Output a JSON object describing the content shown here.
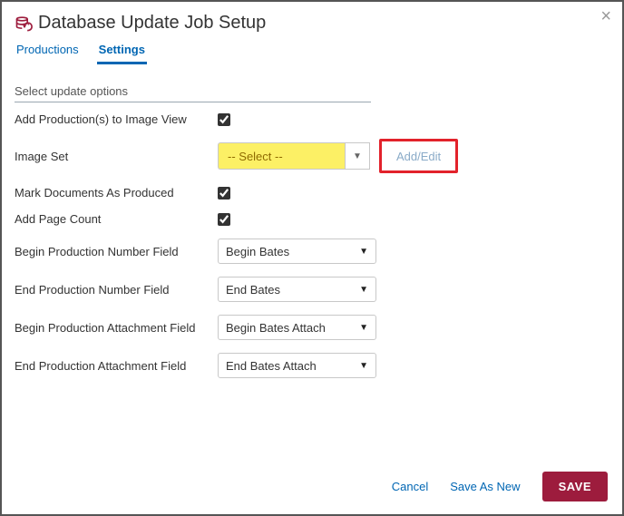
{
  "dialog": {
    "title": "Database Update Job Setup",
    "close_label": "×"
  },
  "tabs": {
    "productions": "Productions",
    "settings": "Settings"
  },
  "section_heading": "Select update options",
  "fields": {
    "add_productions": {
      "label": "Add Production(s) to Image View",
      "checked": true
    },
    "image_set": {
      "label": "Image Set",
      "value": "-- Select --",
      "add_edit": "Add/Edit"
    },
    "mark_produced": {
      "label": "Mark Documents As Produced",
      "checked": true
    },
    "add_page_count": {
      "label": "Add Page Count",
      "checked": true
    },
    "begin_prod_num": {
      "label": "Begin Production Number Field",
      "value": "Begin Bates"
    },
    "end_prod_num": {
      "label": "End Production Number Field",
      "value": "End Bates"
    },
    "begin_prod_attach": {
      "label": "Begin Production Attachment Field",
      "value": "Begin Bates Attach"
    },
    "end_prod_attach": {
      "label": "End Production Attachment Field",
      "value": "End Bates Attach"
    }
  },
  "footer": {
    "cancel": "Cancel",
    "save_as_new": "Save As New",
    "save": "SAVE"
  }
}
